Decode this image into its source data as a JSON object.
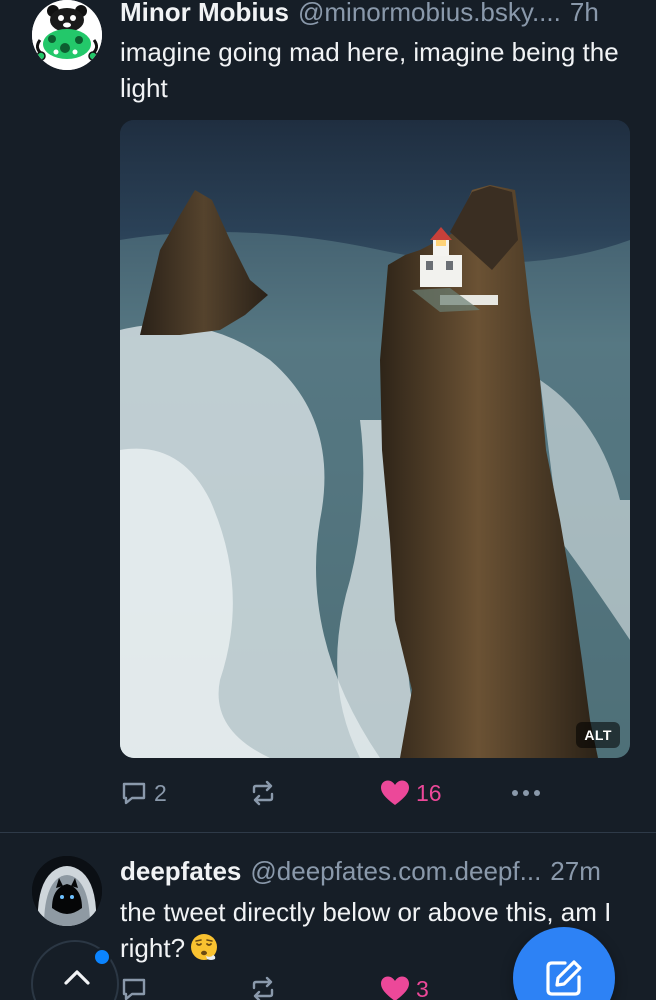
{
  "posts": [
    {
      "author": {
        "display_name": "Minor Mobius",
        "handle": "@minormobius.bsky....",
        "avatar_icon": "green-bear-avatar"
      },
      "timestamp": "7h",
      "text": "imagine going mad here, imagine being the light",
      "media": {
        "kind": "photo",
        "subject": "lighthouse on sea stack",
        "alt_badge": "ALT"
      },
      "actions": {
        "replies": "2",
        "reposts": "",
        "likes": "16",
        "liked": true
      }
    },
    {
      "author": {
        "display_name": "deepfates",
        "handle": "@deepfates.com.deepf...",
        "avatar_icon": "hooded-cat-avatar"
      },
      "timestamp": "27m",
      "text": "the tweet directly below or above this, am I right?",
      "emoji": "face-exhaling-emoji",
      "actions": {
        "replies": "",
        "reposts": "",
        "likes": "3",
        "liked": true
      }
    }
  ],
  "controls": {
    "scroll_top_icon": "chevron-up-icon",
    "compose_icon": "compose-icon",
    "unread_indicator": true
  },
  "colors": {
    "background": "#161e27",
    "text_primary": "#f1f3f5",
    "text_secondary": "#8a99ab",
    "like_pink": "#ec4899",
    "accent_blue": "#2d82f5",
    "divider": "#2e3a48"
  }
}
